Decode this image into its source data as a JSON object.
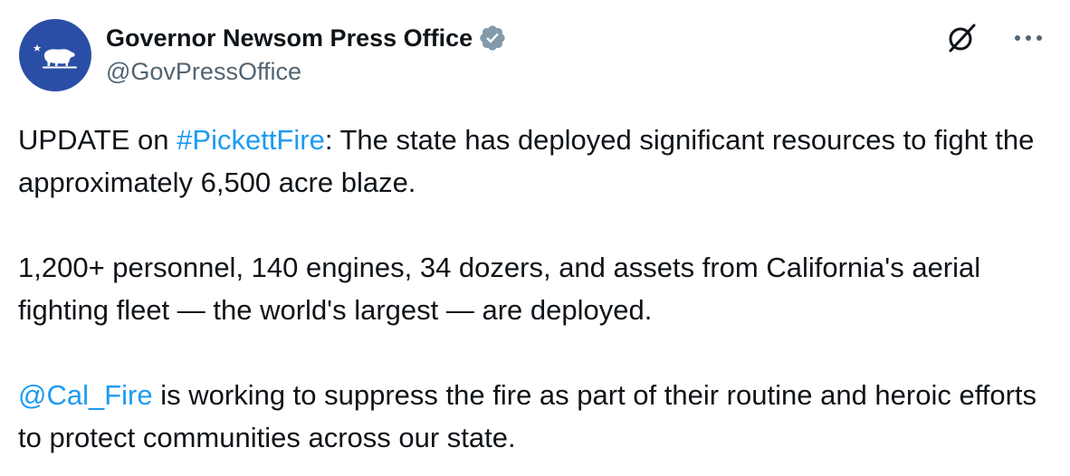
{
  "author": {
    "display_name": "Governor Newsom Press Office",
    "handle": "@GovPressOffice",
    "verified_badge": "gray-check-badge"
  },
  "header_actions": {
    "grok_icon": "grok-icon",
    "more_icon": "more-icon"
  },
  "tweet": {
    "p1_prefix": "UPDATE on ",
    "p1_hashtag": "#PickettFire",
    "p1_rest": ": The state has deployed significant resources to fight the approximately 6,500 acre blaze.",
    "p2": "1,200+ personnel, 140 engines, 34 dozers, and assets from California's aerial fighting fleet — the world's largest — are deployed.",
    "p3_mention": "@Cal_Fire",
    "p3_rest": " is working to suppress the fire as part of their routine and heroic efforts to protect communities across our state."
  },
  "colors": {
    "avatar_bg": "#2a4ea6",
    "link": "#1d9bf0",
    "handle": "#536471",
    "badge": "#829aab"
  }
}
